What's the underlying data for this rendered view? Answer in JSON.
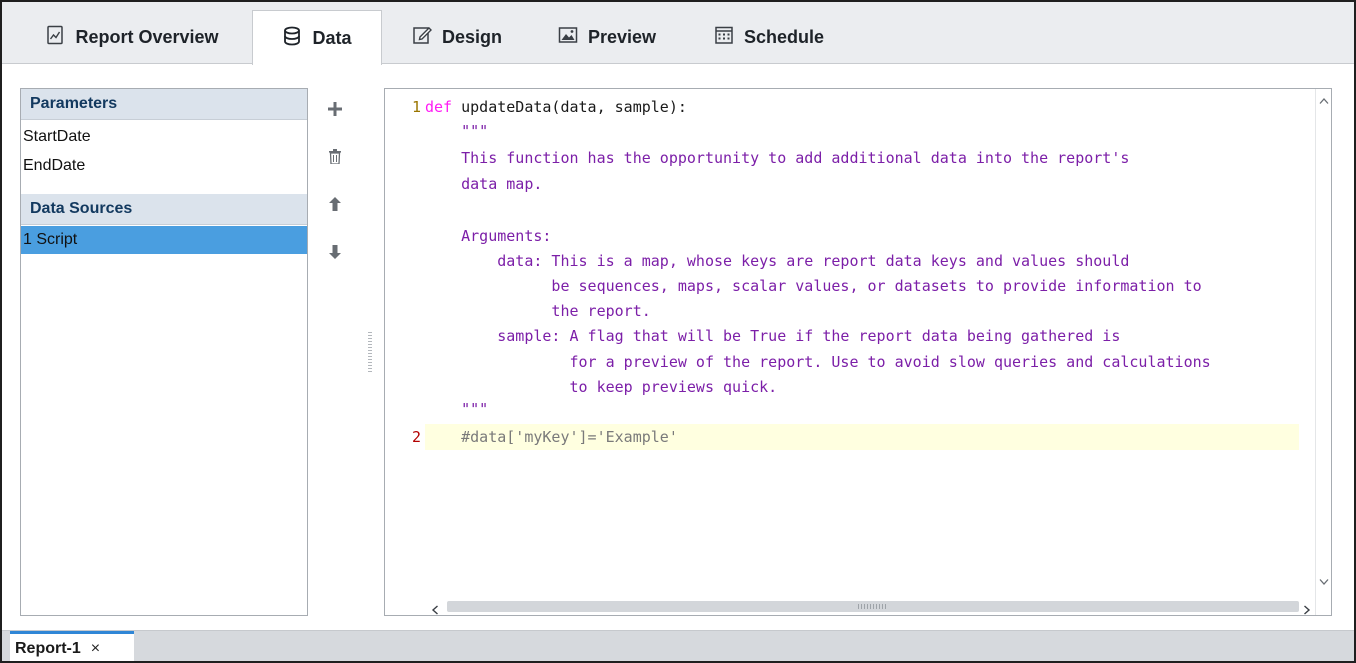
{
  "tabs": [
    {
      "label": "Report Overview",
      "icon": "report-icon"
    },
    {
      "label": "Data",
      "icon": "database-icon",
      "active": true
    },
    {
      "label": "Design",
      "icon": "pencil-icon"
    },
    {
      "label": "Preview",
      "icon": "image-icon"
    },
    {
      "label": "Schedule",
      "icon": "calendar-icon"
    }
  ],
  "left_panel": {
    "parameters_header": "Parameters",
    "parameters": [
      "StartDate",
      "EndDate"
    ],
    "data_sources_header": "Data Sources",
    "data_sources": [
      "1 Script"
    ],
    "selected_data_source": "1 Script"
  },
  "side_buttons": [
    {
      "name": "add",
      "icon": "plus-icon"
    },
    {
      "name": "delete",
      "icon": "trash-icon"
    },
    {
      "name": "move-up",
      "icon": "arrow-up-icon"
    },
    {
      "name": "move-down",
      "icon": "arrow-down-icon"
    }
  ],
  "editor": {
    "line_numbers": [
      "1",
      "2"
    ],
    "lines": [
      {
        "keyword": "def",
        "text": " updateData(data, sample):"
      },
      {
        "text": "    \"\"\""
      },
      {
        "text": "    This function has the opportunity to add additional data into the report's"
      },
      {
        "text": "    data map."
      },
      {
        "text": ""
      },
      {
        "text": "    Arguments:"
      },
      {
        "text": "        data: This is a map, whose keys are report data keys and values should"
      },
      {
        "text": "              be sequences, maps, scalar values, or datasets to provide information to"
      },
      {
        "text": "              the report."
      },
      {
        "text": "        sample: A flag that will be True if the report data being gathered is"
      },
      {
        "text": "                for a preview of the report. Use to avoid slow queries and calculations"
      },
      {
        "text": "                to keep previews quick."
      },
      {
        "text": "    \"\"\""
      },
      {
        "text": "    #data['myKey']='Example'"
      }
    ],
    "colors": {
      "keyword": "#ff1cf4",
      "docstring": "#7c1fa8",
      "comment": "#7a7a7a",
      "line_number_1": "#9a7500",
      "line_number_2": "#b30000",
      "current_line_highlight": "#ffffe0"
    }
  },
  "bottom": {
    "doc_tab_label": "Report-1",
    "close_glyph": "×"
  },
  "colors": {
    "selection": "#4a9ee0",
    "section_header_bg": "#dbe3ec",
    "section_header_text": "#12395f",
    "active_tab_indicator": "#2f86d6"
  }
}
